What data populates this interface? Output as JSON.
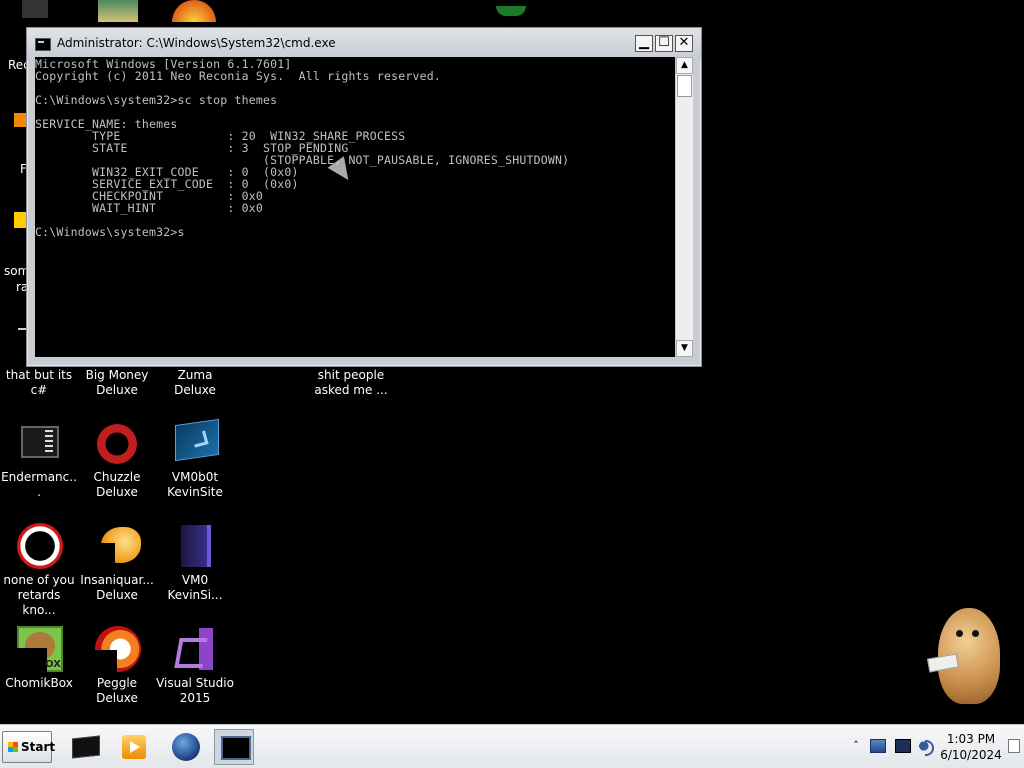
{
  "cmd": {
    "title": "Administrator: C:\\Windows\\System32\\cmd.exe",
    "buttons": {
      "minimize": "▁",
      "maximize": "☐",
      "close": "✕"
    },
    "lines": [
      "Microsoft Windows [Version 6.1.7601]",
      "Copyright (c) 2011 Neo Reconia Sys.  All rights reserved.",
      "",
      "C:\\Windows\\system32>sc stop themes",
      "",
      "SERVICE_NAME: themes",
      "        TYPE               : 20  WIN32_SHARE_PROCESS",
      "        STATE              : 3  STOP_PENDING",
      "                                (STOPPABLE, NOT_PAUSABLE, IGNORES_SHUTDOWN)",
      "        WIN32_EXIT_CODE    : 0  (0x0)",
      "        SERVICE_EXIT_CODE  : 0  (0x0)",
      "        CHECKPOINT         : 0x0",
      "        WAIT_HINT          : 0x0",
      "",
      "C:\\Windows\\system32>s"
    ],
    "scroll": {
      "up": "▲",
      "down": "▼"
    }
  },
  "desktop": {
    "partial_labels": [
      "Rec",
      "F",
      "som",
      "ra"
    ],
    "row_labels": {
      "that_but_c": "that but its c#",
      "big_money": "Big Money Deluxe",
      "zuma": "Zuma Deluxe",
      "shit_people": "shit people asked me ..."
    },
    "icons": {
      "endermanch": "Endermanc...",
      "chuzzle": "Chuzzle Deluxe",
      "vm0b0t": "VM0b0t KevinSite",
      "none_of_you": "none of you retards kno...",
      "insaniquarium": "Insaniquar... Deluxe",
      "vm0": "VM0 KevinSi...",
      "chomikbox": "ChomikBox",
      "chomikbox_badge": "OX",
      "peggle": "Peggle Deluxe",
      "visual_studio": "Visual Studio 2015"
    }
  },
  "taskbar": {
    "start_label": "Start",
    "tray_chevron": "˄",
    "clock_time": "1:03 PM",
    "clock_date": "6/10/2024"
  }
}
